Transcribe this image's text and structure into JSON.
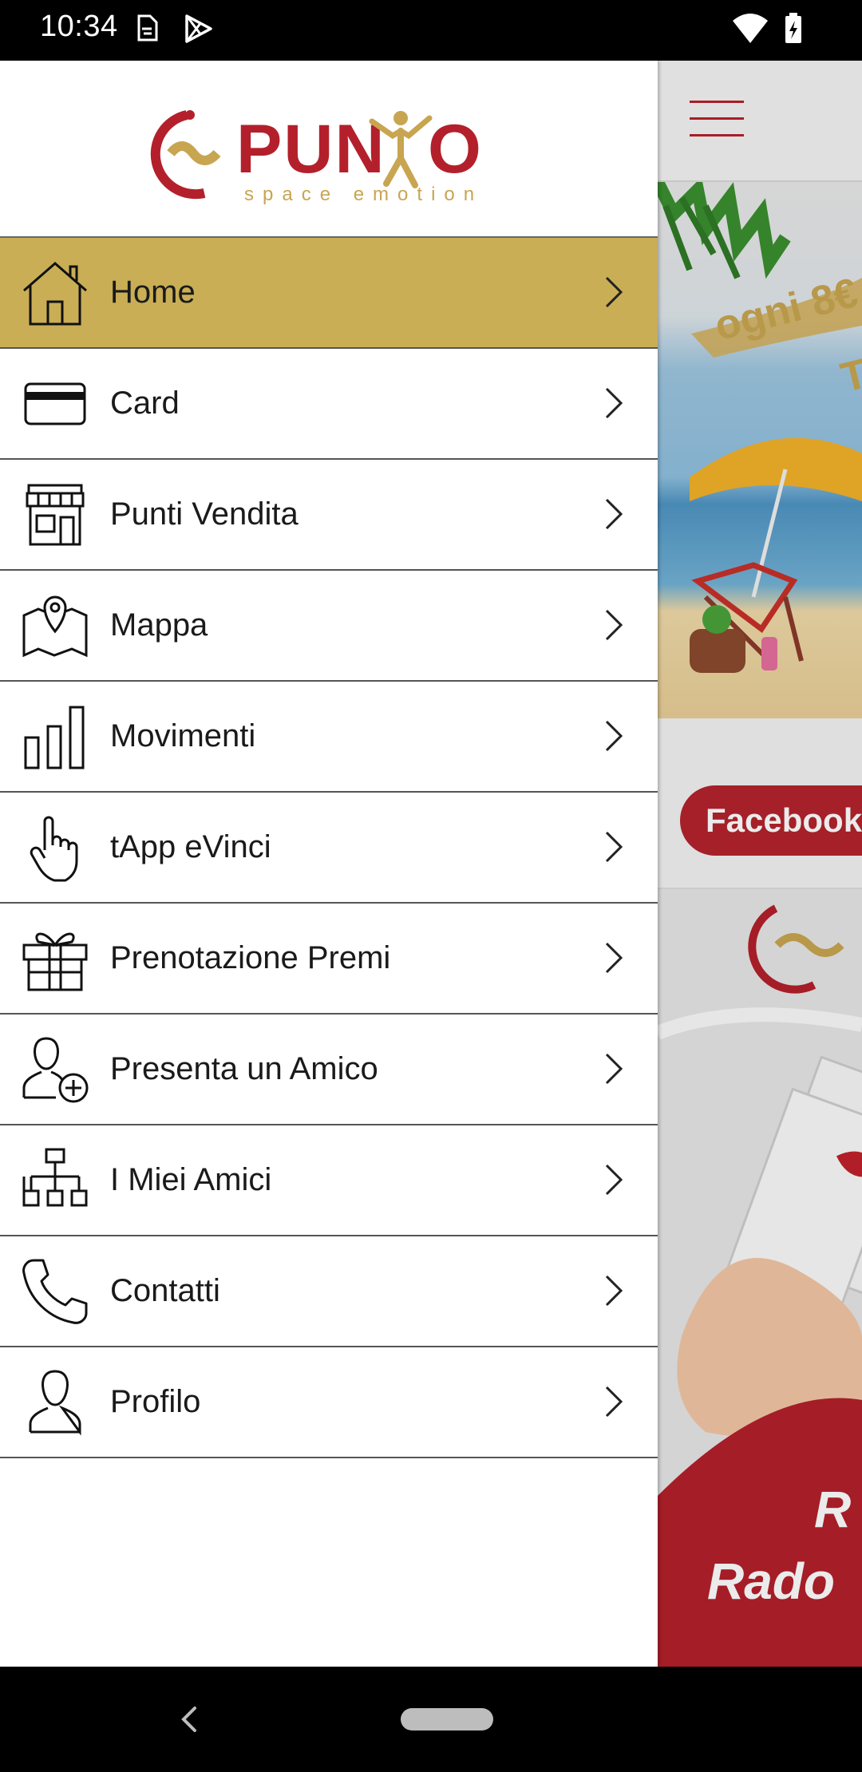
{
  "status_bar": {
    "time": "10:34",
    "icons": [
      "sim-card-icon",
      "play-store-icon",
      "wifi-icon",
      "battery-charging-icon"
    ]
  },
  "app": {
    "banner_text_1": "ogni 8€",
    "banner_text_2": "Ta",
    "facebook_label": "Facebook",
    "banner_text_3": "R",
    "banner_text_4": "Rado"
  },
  "drawer": {
    "logo_text_left": "PUN",
    "logo_text_right": "O",
    "logo_tagline": "space emotion",
    "items": [
      {
        "label": "Home",
        "icon": "home-icon",
        "active": true
      },
      {
        "label": "Card",
        "icon": "credit-card-icon",
        "active": false
      },
      {
        "label": "Punti Vendita",
        "icon": "store-icon",
        "active": false
      },
      {
        "label": "Mappa",
        "icon": "map-pin-icon",
        "active": false
      },
      {
        "label": "Movimenti",
        "icon": "bar-chart-icon",
        "active": false
      },
      {
        "label": "tApp eVinci",
        "icon": "tap-hand-icon",
        "active": false
      },
      {
        "label": "Prenotazione Premi",
        "icon": "gift-icon",
        "active": false
      },
      {
        "label": "Presenta un Amico",
        "icon": "add-user-icon",
        "active": false
      },
      {
        "label": "I Miei Amici",
        "icon": "org-chart-icon",
        "active": false
      },
      {
        "label": "Contatti",
        "icon": "phone-icon",
        "active": false
      },
      {
        "label": "Profilo",
        "icon": "user-icon",
        "active": false
      }
    ]
  },
  "colors": {
    "active_item": "#c9ae55",
    "brand_red": "#b3202b",
    "brand_gold": "#c8a550"
  }
}
